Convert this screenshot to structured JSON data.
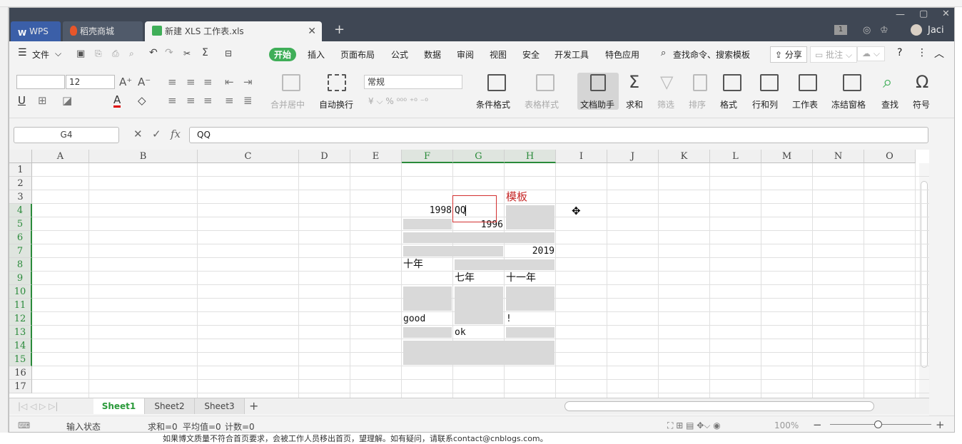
{
  "titlebar": {
    "wps_tab": "WPS",
    "shop_tab": "稻壳商城",
    "file_tab": "新建 XLS 工作表.xls",
    "user": "Jaci",
    "badge": "1"
  },
  "menu": {
    "file": "文件",
    "items": [
      "开始",
      "插入",
      "页面布局",
      "公式",
      "数据",
      "审阅",
      "视图",
      "安全",
      "开发工具",
      "特色应用"
    ],
    "search": "查找命令、搜索模板",
    "share": "分享",
    "comment": "批注"
  },
  "toolbar": {
    "font_size": "12",
    "number_format": "常规",
    "merge": "合并居中",
    "wrap": "自动换行",
    "cond_format": "条件格式",
    "table_style": "表格样式",
    "doc_assist": "文档助手",
    "sum": "求和",
    "filter": "筛选",
    "sort": "排序",
    "format": "格式",
    "rowcol": "行和列",
    "sheet": "工作表",
    "freeze": "冻结窗格",
    "find": "查找",
    "symbol": "符号"
  },
  "formula": {
    "cell_ref": "G4",
    "fx": "fx",
    "value": "QQ"
  },
  "grid": {
    "columns": [
      "A",
      "B",
      "C",
      "D",
      "E",
      "F",
      "G",
      "H",
      "I",
      "J",
      "K",
      "L",
      "M",
      "N",
      "O"
    ],
    "rows": [
      "1",
      "2",
      "3",
      "4",
      "5",
      "6",
      "7",
      "8",
      "9",
      "10",
      "11",
      "12",
      "13",
      "14",
      "15",
      "16",
      "17"
    ],
    "cells": {
      "H3": "模板",
      "F4": "1998",
      "G4": "QQ",
      "G5": "1996",
      "H7": "2019",
      "F8": "十年",
      "G9": "七年",
      "H9": "十一年",
      "F12": "good",
      "H12": "!",
      "G13": "ok"
    }
  },
  "sheets": [
    "Sheet1",
    "Sheet2",
    "Sheet3"
  ],
  "status": {
    "mode": "输入状态",
    "sum": "求和=0",
    "avg": "平均值=0",
    "count": "计数=0",
    "zoom": "100%"
  },
  "background_text": "如果博文质量不符合首页要求，会被工作人员移出首页，望理解。如有疑问，请联系contact@cnblogs.com。",
  "colors": {
    "accent": "#3fae58",
    "titlebar": "#3f4754",
    "selection": "#d32f2f",
    "template_text": "#c62828"
  }
}
